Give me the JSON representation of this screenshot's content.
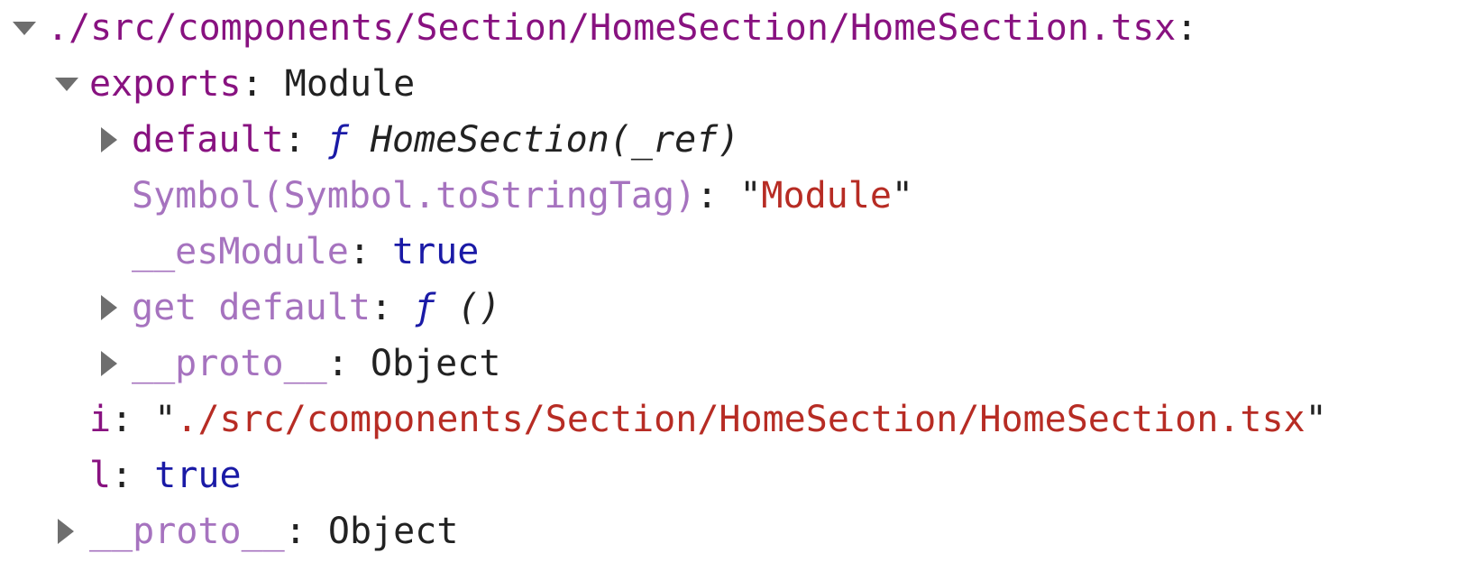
{
  "tree": {
    "root": {
      "key": "./src/components/Section/HomeSection/HomeSection.tsx",
      "sep": ":"
    },
    "exports": {
      "key": "exports",
      "sep": ": ",
      "value": "Module"
    },
    "default": {
      "key": "default",
      "sep": ": ",
      "f": "ƒ",
      "sig": " HomeSection(_ref)"
    },
    "to_string_tag": {
      "key": "Symbol(Symbol.toStringTag)",
      "sep": ": ",
      "quote_open": "\"",
      "value": "Module",
      "quote_close": "\""
    },
    "es_module": {
      "key": "__esModule",
      "sep": ": ",
      "value": "true"
    },
    "get_default": {
      "key": "get default",
      "sep": ": ",
      "f": "ƒ",
      "sig": " ()"
    },
    "proto_inner": {
      "key": "__proto__",
      "sep": ": ",
      "value": "Object"
    },
    "i": {
      "key": "i",
      "sep": ": ",
      "quote_open": "\"",
      "value": "./src/components/Section/HomeSection/HomeSection.tsx",
      "quote_close": "\""
    },
    "l": {
      "key": "l",
      "sep": ": ",
      "value": "true"
    },
    "proto_outer": {
      "key": "__proto__",
      "sep": ": ",
      "value": "Object"
    }
  },
  "colors": {
    "own_property_key": "#881280",
    "inherited_property_key": "#a673bf",
    "string_value": "#b72c24",
    "boolean_value": "#1a1aa6",
    "plain_text": "#222222",
    "disclosure_triangle": "#6e6e6e",
    "background": "#ffffff"
  },
  "icons": {
    "expanded": "triangle-down-icon",
    "collapsed": "triangle-right-icon"
  }
}
